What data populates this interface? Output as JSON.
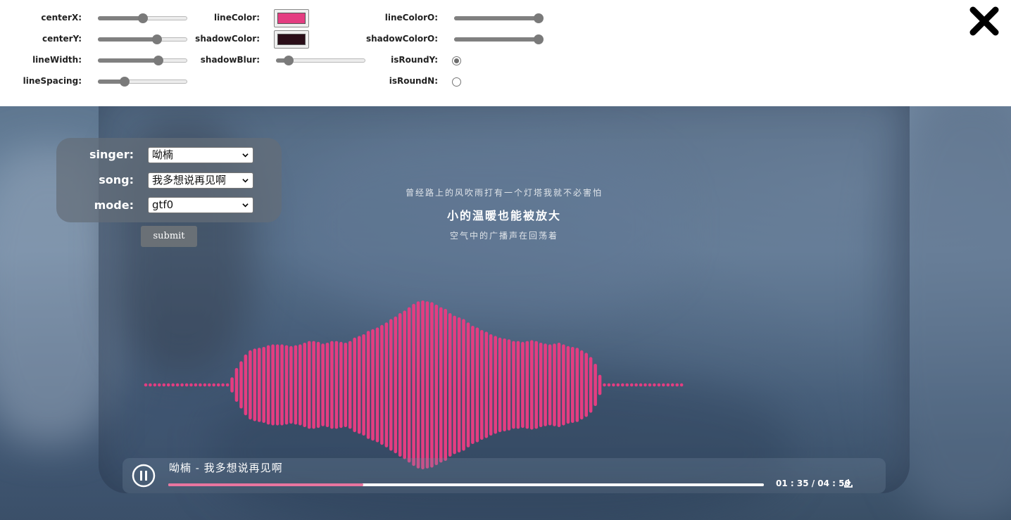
{
  "controls": {
    "centerX": {
      "label": "centerX:",
      "value": 0.5
    },
    "centerY": {
      "label": "centerY:",
      "value": 0.68
    },
    "lineWidth": {
      "label": "lineWidth:",
      "value": 0.7
    },
    "lineSpacing": {
      "label": "lineSpacing:",
      "value": 0.27
    },
    "lineColor": {
      "label": "lineColor:",
      "value": "#e43d81"
    },
    "shadowColor": {
      "label": "shadowColor:",
      "value": "#2a0d18"
    },
    "shadowBlur": {
      "label": "shadowBlur:",
      "value": 0.1
    },
    "lineColorO": {
      "label": "lineColorO:",
      "value": 1.0
    },
    "shadowColorO": {
      "label": "shadowColorO:",
      "value": 1.0
    },
    "isRoundY": {
      "label": "isRoundY:",
      "checked": true
    },
    "isRoundN": {
      "label": "isRoundN:",
      "checked": false
    },
    "close_icon": "close-icon"
  },
  "selector": {
    "singer_label": "singer:",
    "singer_value": "呦楠",
    "song_label": "song:",
    "song_value": "我多想说再见啊",
    "mode_label": "mode:",
    "mode_value": "gtf0",
    "submit_label": "submit"
  },
  "lyrics": {
    "prev": "曾经路上的风吹雨打有一个灯塔我就不必害怕",
    "current": "小的温暖也能被放大",
    "next": "空气中的广播声在回荡着"
  },
  "player": {
    "now_playing": "呦楠 - 我多想说再见啊",
    "time": "01 : 35 / 04 : 50",
    "progress": 0.327,
    "state_icon": "pause-icon",
    "download_icon": "download-icon"
  },
  "visualizer": {
    "color": "#e43d81",
    "bar_amplitudes": [
      0,
      0,
      0,
      0,
      0,
      0,
      0,
      0,
      0,
      0,
      0,
      0,
      0,
      0,
      0,
      0,
      0,
      0,
      0,
      0.09,
      0.2,
      0.28,
      0.36,
      0.41,
      0.43,
      0.44,
      0.45,
      0.47,
      0.48,
      0.48,
      0.48,
      0.47,
      0.46,
      0.47,
      0.48,
      0.5,
      0.52,
      0.52,
      0.51,
      0.49,
      0.5,
      0.52,
      0.52,
      0.51,
      0.5,
      0.52,
      0.56,
      0.58,
      0.6,
      0.64,
      0.66,
      0.68,
      0.71,
      0.74,
      0.78,
      0.81,
      0.85,
      0.88,
      0.92,
      0.96,
      0.99,
      1.0,
      0.99,
      0.98,
      0.95,
      0.92,
      0.9,
      0.85,
      0.82,
      0.8,
      0.78,
      0.74,
      0.7,
      0.68,
      0.65,
      0.63,
      0.6,
      0.58,
      0.56,
      0.55,
      0.54,
      0.52,
      0.52,
      0.51,
      0.52,
      0.53,
      0.52,
      0.5,
      0.49,
      0.48,
      0.49,
      0.5,
      0.48,
      0.46,
      0.45,
      0.44,
      0.41,
      0.38,
      0.33,
      0.25,
      0.12,
      0,
      0,
      0,
      0,
      0,
      0,
      0,
      0,
      0,
      0,
      0,
      0,
      0,
      0,
      0,
      0,
      0,
      0
    ]
  }
}
